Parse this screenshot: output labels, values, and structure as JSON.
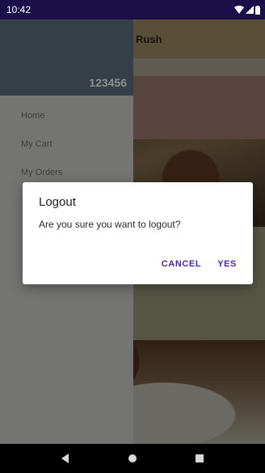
{
  "status_bar": {
    "time": "10:42",
    "icons": [
      "wifi-icon",
      "signal-icon",
      "battery-icon"
    ]
  },
  "toolbar": {
    "title": "Rush"
  },
  "drawer": {
    "user_id": "123456",
    "items": [
      {
        "label": "Home"
      },
      {
        "label": "My Cart"
      },
      {
        "label": "My Orders"
      }
    ]
  },
  "dialog": {
    "title": "Logout",
    "message": "Are you sure you want to logout?",
    "cancel_label": "CANCEL",
    "confirm_label": "YES"
  },
  "nav_bar": {
    "icons": [
      "back-icon",
      "home-icon",
      "recents-icon"
    ]
  },
  "colors": {
    "status_bar": "#1b0f4a",
    "dialog_accent": "#4a22b8",
    "drawer_header": "#505d6b"
  }
}
